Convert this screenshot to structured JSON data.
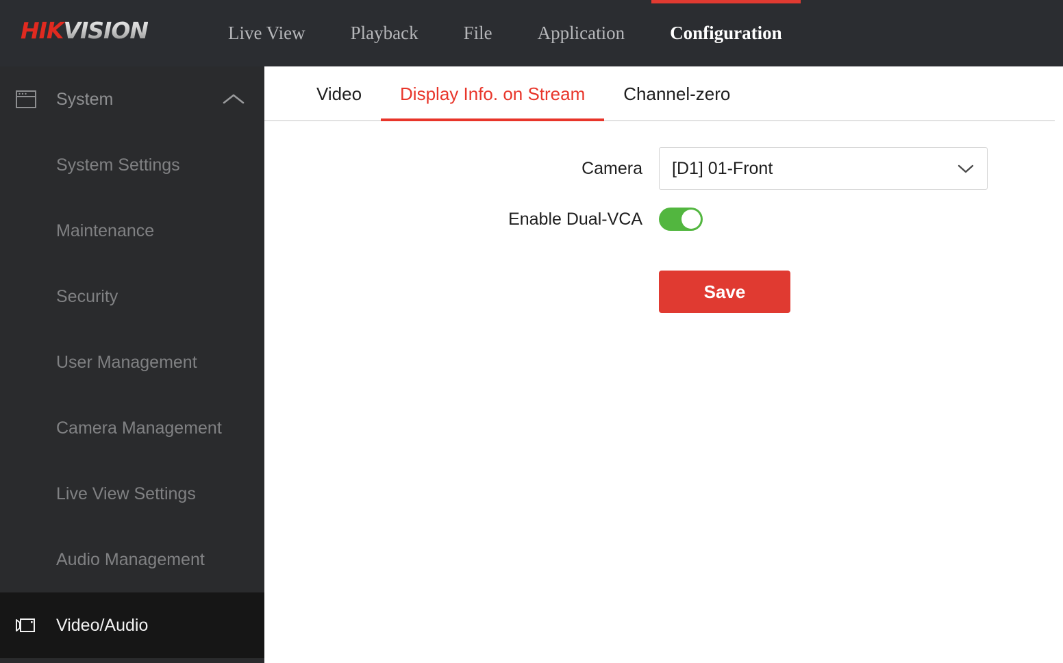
{
  "brand": {
    "name_part1": "HIK",
    "name_part2": "VISION",
    "red": "#e02a20"
  },
  "header": {
    "nav": [
      {
        "label": "Live View",
        "active": false
      },
      {
        "label": "Playback",
        "active": false
      },
      {
        "label": "File",
        "active": false
      },
      {
        "label": "Application",
        "active": false
      },
      {
        "label": "Configuration",
        "active": true
      }
    ],
    "background": "#2b2d31",
    "active_accent": "#e03a31"
  },
  "sidebar": {
    "group": {
      "label": "System",
      "icon": "window-icon",
      "expanded_icon": "chevron-up-icon"
    },
    "items": [
      {
        "label": "System Settings"
      },
      {
        "label": "Maintenance"
      },
      {
        "label": "Security"
      },
      {
        "label": "User Management"
      },
      {
        "label": "Camera Management"
      },
      {
        "label": "Live View Settings"
      },
      {
        "label": "Audio Management"
      }
    ],
    "active_item": {
      "label": "Video/Audio",
      "icon": "video-camera-icon"
    }
  },
  "main": {
    "tabs": [
      {
        "label": "Video",
        "active": false
      },
      {
        "label": "Display Info. on Stream",
        "active": true
      },
      {
        "label": "Channel-zero",
        "active": false
      }
    ],
    "tab_accent": "#e8352a",
    "form": {
      "camera": {
        "label": "Camera",
        "value": "[D1] 01-Front",
        "chevron": "chevron-down-icon"
      },
      "dual_vca": {
        "label": "Enable Dual-VCA",
        "state": "on",
        "on_color": "#52b63f"
      },
      "save_label": "Save",
      "save_color": "#e03a31"
    }
  }
}
